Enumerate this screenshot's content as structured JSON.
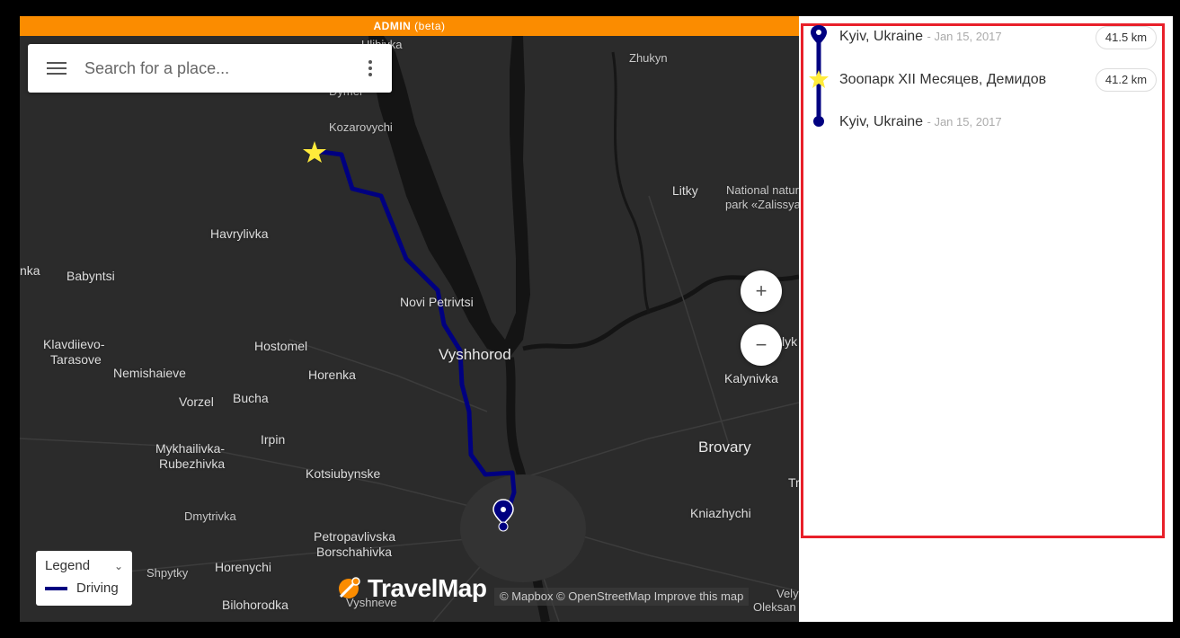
{
  "admin_bar": {
    "label": "ADMIN",
    "beta": "(beta)"
  },
  "search": {
    "placeholder": "Search for a place..."
  },
  "zoom": {
    "in": "+",
    "out": "−"
  },
  "legend": {
    "title": "Legend",
    "entry": "Driving",
    "color": "#000080"
  },
  "brand": {
    "name": "TravelMap"
  },
  "attribution": "© Mapbox © OpenStreetMap Improve this map",
  "places": [
    "Ulibivka",
    "Dymer",
    "Kozarovychi",
    "Zhukyn",
    "Litky",
    "National natur",
    "park «Zalissya",
    "Havrylivka",
    "Babyntsi",
    "nka",
    "Novi Petrivtsi",
    "Klavdiievo-",
    "Tarasove",
    "Hostomel",
    "Vyshhorod",
    "Nemishaieve",
    "Horenka",
    "Vorzel",
    "Bucha",
    "Kalynivka",
    "lyk",
    "Irpin",
    "Brovary",
    "Mykhailivka-",
    "Rubezhivka",
    "Kotsiubynske",
    "Tr",
    "Dmytrivka",
    "Kniazhychi",
    "Petropavlivska",
    "Borschahivka",
    "Shpytky",
    "Horenychi",
    "Bilohorodka",
    "Vyshneve",
    "Vely",
    "Oleksan"
  ],
  "route": [
    {
      "name": "Kyiv, Ukraine",
      "date": "- Jan 15, 2017",
      "distance": "41.5 km"
    },
    {
      "name": "Зоопарк XII Месяцев, Демидов",
      "date": "",
      "distance": "41.2 km"
    },
    {
      "name": "Kyiv, Ukraine",
      "date": "- Jan 15, 2017",
      "distance": ""
    }
  ],
  "colors": {
    "route": "#000080",
    "admin": "#fb8c00",
    "highlight": "#e8202a",
    "star": "#ffeb3b"
  }
}
